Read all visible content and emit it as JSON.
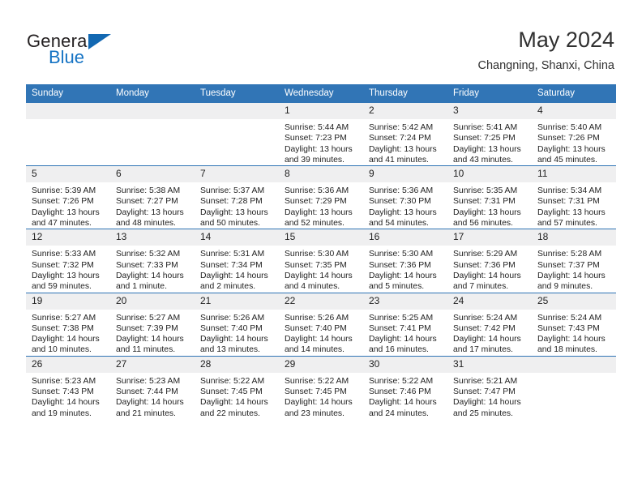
{
  "brand": {
    "name_part1": "General",
    "name_part2": "Blue",
    "triangle_icon": "triangle-icon",
    "accent_color": "#1268b2"
  },
  "header": {
    "title": "May 2024",
    "location": "Changning, Shanxi, China"
  },
  "theme": {
    "header_blue": "#3175b6",
    "row_divider_blue": "#2f74b5",
    "daynum_band": "#efeff0"
  },
  "weekday_headers": [
    "Sunday",
    "Monday",
    "Tuesday",
    "Wednesday",
    "Thursday",
    "Friday",
    "Saturday"
  ],
  "weeks": [
    [
      {
        "day": "",
        "empty": true,
        "sunrise": "",
        "sunset": "",
        "daylight1": "",
        "daylight2": ""
      },
      {
        "day": "",
        "empty": true,
        "sunrise": "",
        "sunset": "",
        "daylight1": "",
        "daylight2": ""
      },
      {
        "day": "",
        "empty": true,
        "sunrise": "",
        "sunset": "",
        "daylight1": "",
        "daylight2": ""
      },
      {
        "day": "1",
        "sunrise": "Sunrise: 5:44 AM",
        "sunset": "Sunset: 7:23 PM",
        "daylight1": "Daylight: 13 hours",
        "daylight2": "and 39 minutes."
      },
      {
        "day": "2",
        "sunrise": "Sunrise: 5:42 AM",
        "sunset": "Sunset: 7:24 PM",
        "daylight1": "Daylight: 13 hours",
        "daylight2": "and 41 minutes."
      },
      {
        "day": "3",
        "sunrise": "Sunrise: 5:41 AM",
        "sunset": "Sunset: 7:25 PM",
        "daylight1": "Daylight: 13 hours",
        "daylight2": "and 43 minutes."
      },
      {
        "day": "4",
        "sunrise": "Sunrise: 5:40 AM",
        "sunset": "Sunset: 7:26 PM",
        "daylight1": "Daylight: 13 hours",
        "daylight2": "and 45 minutes."
      }
    ],
    [
      {
        "day": "5",
        "sunrise": "Sunrise: 5:39 AM",
        "sunset": "Sunset: 7:26 PM",
        "daylight1": "Daylight: 13 hours",
        "daylight2": "and 47 minutes."
      },
      {
        "day": "6",
        "sunrise": "Sunrise: 5:38 AM",
        "sunset": "Sunset: 7:27 PM",
        "daylight1": "Daylight: 13 hours",
        "daylight2": "and 48 minutes."
      },
      {
        "day": "7",
        "sunrise": "Sunrise: 5:37 AM",
        "sunset": "Sunset: 7:28 PM",
        "daylight1": "Daylight: 13 hours",
        "daylight2": "and 50 minutes."
      },
      {
        "day": "8",
        "sunrise": "Sunrise: 5:36 AM",
        "sunset": "Sunset: 7:29 PM",
        "daylight1": "Daylight: 13 hours",
        "daylight2": "and 52 minutes."
      },
      {
        "day": "9",
        "sunrise": "Sunrise: 5:36 AM",
        "sunset": "Sunset: 7:30 PM",
        "daylight1": "Daylight: 13 hours",
        "daylight2": "and 54 minutes."
      },
      {
        "day": "10",
        "sunrise": "Sunrise: 5:35 AM",
        "sunset": "Sunset: 7:31 PM",
        "daylight1": "Daylight: 13 hours",
        "daylight2": "and 56 minutes."
      },
      {
        "day": "11",
        "sunrise": "Sunrise: 5:34 AM",
        "sunset": "Sunset: 7:31 PM",
        "daylight1": "Daylight: 13 hours",
        "daylight2": "and 57 minutes."
      }
    ],
    [
      {
        "day": "12",
        "sunrise": "Sunrise: 5:33 AM",
        "sunset": "Sunset: 7:32 PM",
        "daylight1": "Daylight: 13 hours",
        "daylight2": "and 59 minutes."
      },
      {
        "day": "13",
        "sunrise": "Sunrise: 5:32 AM",
        "sunset": "Sunset: 7:33 PM",
        "daylight1": "Daylight: 14 hours",
        "daylight2": "and 1 minute."
      },
      {
        "day": "14",
        "sunrise": "Sunrise: 5:31 AM",
        "sunset": "Sunset: 7:34 PM",
        "daylight1": "Daylight: 14 hours",
        "daylight2": "and 2 minutes."
      },
      {
        "day": "15",
        "sunrise": "Sunrise: 5:30 AM",
        "sunset": "Sunset: 7:35 PM",
        "daylight1": "Daylight: 14 hours",
        "daylight2": "and 4 minutes."
      },
      {
        "day": "16",
        "sunrise": "Sunrise: 5:30 AM",
        "sunset": "Sunset: 7:36 PM",
        "daylight1": "Daylight: 14 hours",
        "daylight2": "and 5 minutes."
      },
      {
        "day": "17",
        "sunrise": "Sunrise: 5:29 AM",
        "sunset": "Sunset: 7:36 PM",
        "daylight1": "Daylight: 14 hours",
        "daylight2": "and 7 minutes."
      },
      {
        "day": "18",
        "sunrise": "Sunrise: 5:28 AM",
        "sunset": "Sunset: 7:37 PM",
        "daylight1": "Daylight: 14 hours",
        "daylight2": "and 9 minutes."
      }
    ],
    [
      {
        "day": "19",
        "sunrise": "Sunrise: 5:27 AM",
        "sunset": "Sunset: 7:38 PM",
        "daylight1": "Daylight: 14 hours",
        "daylight2": "and 10 minutes."
      },
      {
        "day": "20",
        "sunrise": "Sunrise: 5:27 AM",
        "sunset": "Sunset: 7:39 PM",
        "daylight1": "Daylight: 14 hours",
        "daylight2": "and 11 minutes."
      },
      {
        "day": "21",
        "sunrise": "Sunrise: 5:26 AM",
        "sunset": "Sunset: 7:40 PM",
        "daylight1": "Daylight: 14 hours",
        "daylight2": "and 13 minutes."
      },
      {
        "day": "22",
        "sunrise": "Sunrise: 5:26 AM",
        "sunset": "Sunset: 7:40 PM",
        "daylight1": "Daylight: 14 hours",
        "daylight2": "and 14 minutes."
      },
      {
        "day": "23",
        "sunrise": "Sunrise: 5:25 AM",
        "sunset": "Sunset: 7:41 PM",
        "daylight1": "Daylight: 14 hours",
        "daylight2": "and 16 minutes."
      },
      {
        "day": "24",
        "sunrise": "Sunrise: 5:24 AM",
        "sunset": "Sunset: 7:42 PM",
        "daylight1": "Daylight: 14 hours",
        "daylight2": "and 17 minutes."
      },
      {
        "day": "25",
        "sunrise": "Sunrise: 5:24 AM",
        "sunset": "Sunset: 7:43 PM",
        "daylight1": "Daylight: 14 hours",
        "daylight2": "and 18 minutes."
      }
    ],
    [
      {
        "day": "26",
        "sunrise": "Sunrise: 5:23 AM",
        "sunset": "Sunset: 7:43 PM",
        "daylight1": "Daylight: 14 hours",
        "daylight2": "and 19 minutes."
      },
      {
        "day": "27",
        "sunrise": "Sunrise: 5:23 AM",
        "sunset": "Sunset: 7:44 PM",
        "daylight1": "Daylight: 14 hours",
        "daylight2": "and 21 minutes."
      },
      {
        "day": "28",
        "sunrise": "Sunrise: 5:22 AM",
        "sunset": "Sunset: 7:45 PM",
        "daylight1": "Daylight: 14 hours",
        "daylight2": "and 22 minutes."
      },
      {
        "day": "29",
        "sunrise": "Sunrise: 5:22 AM",
        "sunset": "Sunset: 7:45 PM",
        "daylight1": "Daylight: 14 hours",
        "daylight2": "and 23 minutes."
      },
      {
        "day": "30",
        "sunrise": "Sunrise: 5:22 AM",
        "sunset": "Sunset: 7:46 PM",
        "daylight1": "Daylight: 14 hours",
        "daylight2": "and 24 minutes."
      },
      {
        "day": "31",
        "sunrise": "Sunrise: 5:21 AM",
        "sunset": "Sunset: 7:47 PM",
        "daylight1": "Daylight: 14 hours",
        "daylight2": "and 25 minutes."
      },
      {
        "day": "",
        "empty": true,
        "sunrise": "",
        "sunset": "",
        "daylight1": "",
        "daylight2": ""
      }
    ]
  ]
}
